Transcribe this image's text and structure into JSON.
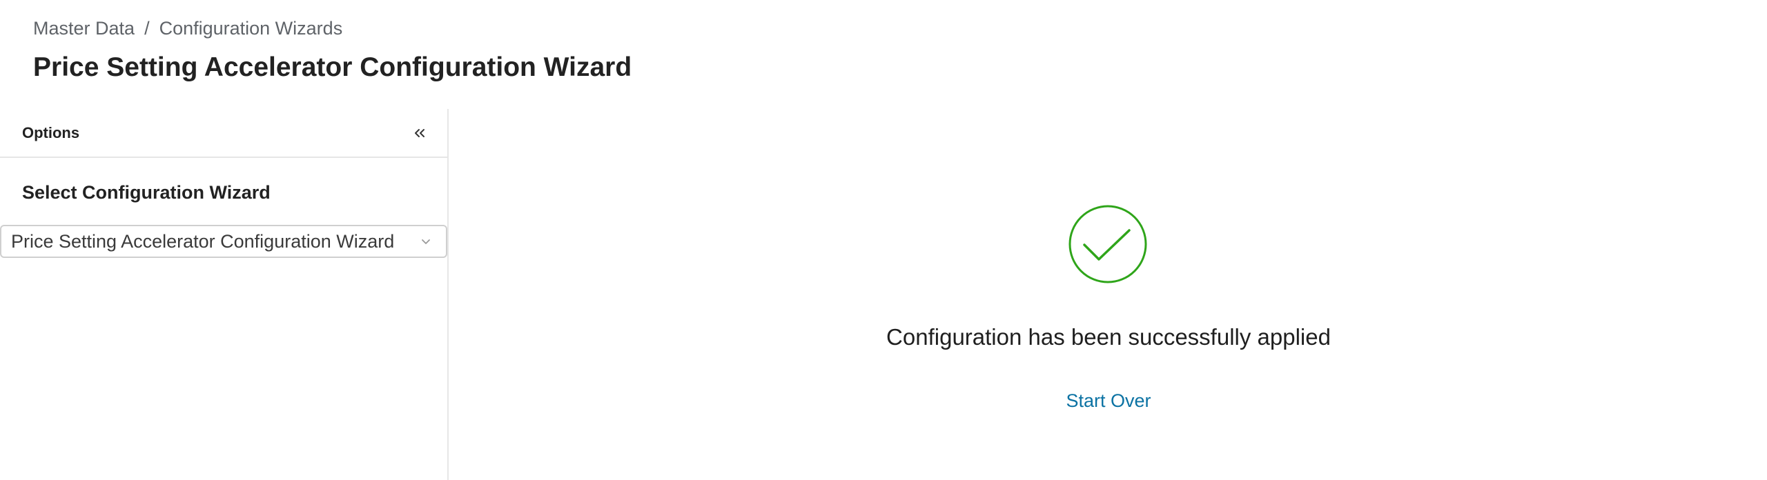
{
  "breadcrumb": {
    "items": [
      "Master Data",
      "Configuration Wizards"
    ],
    "separator": "/"
  },
  "page": {
    "title": "Price Setting Accelerator Configuration Wizard"
  },
  "sidebar": {
    "title": "Options",
    "collapse_icon": "double-chevron-left-icon",
    "section_title": "Select Configuration Wizard",
    "select": {
      "value": "Price Setting Accelerator Configuration Wizard",
      "icon": "chevron-down-icon"
    }
  },
  "main": {
    "status_icon": "check-circle-icon",
    "message": "Configuration has been successfully applied",
    "start_over_label": "Start Over"
  },
  "colors": {
    "success": "#2fa51a",
    "link": "#0b72a3",
    "border": "#e6e6e6",
    "muted_text": "#5f6368"
  }
}
